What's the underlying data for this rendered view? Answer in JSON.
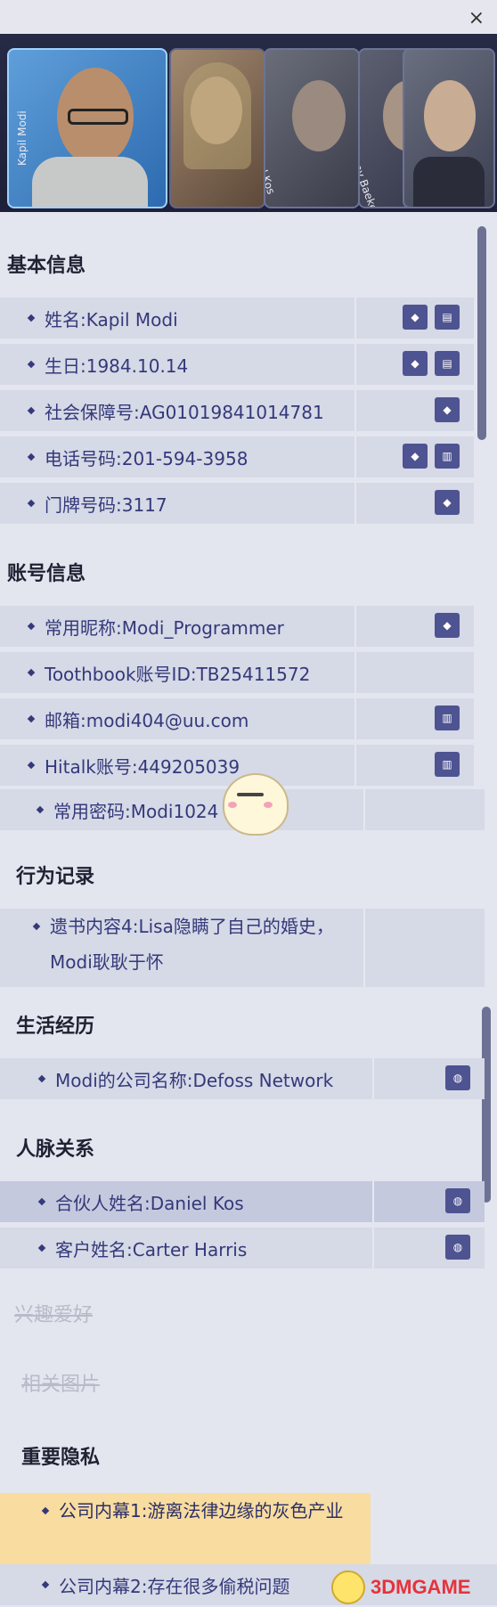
{
  "window": {
    "close_label": "×"
  },
  "characters": [
    {
      "name": "Kapil Modi",
      "active": true
    },
    {
      "name": ""
    },
    {
      "name": "Daniel Kos"
    },
    {
      "name": "Antony Baekeland"
    },
    {
      "name": ""
    }
  ],
  "sections": {
    "basic": {
      "title": "基本信息",
      "rows": [
        {
          "label": "姓名:Kapil Modi",
          "icons": [
            "shield-icon",
            "id-card-icon"
          ]
        },
        {
          "label": "生日:1984.10.14",
          "icons": [
            "shield-icon",
            "id-card-icon"
          ]
        },
        {
          "label": "社会保障号:AG01019841014781",
          "icons": [
            "shield-icon"
          ]
        },
        {
          "label": "电话号码:201-594-3958",
          "icons": [
            "shield-icon",
            "document-icon"
          ]
        },
        {
          "label": "门牌号码:3117",
          "icons": [
            "shield-icon"
          ]
        }
      ]
    },
    "account": {
      "title": "账号信息",
      "rows": [
        {
          "label": "常用昵称:Modi_Programmer",
          "icons": [
            "shield-icon"
          ]
        },
        {
          "label": "Toothbook账号ID:TB25411572",
          "icons": []
        },
        {
          "label": "邮箱:modi404@uu.com",
          "icons": [
            "document-icon"
          ]
        },
        {
          "label": "Hitalk账号:449205039",
          "icons": [
            "document-icon"
          ]
        },
        {
          "label": "常用密码:Modi1024",
          "icons": []
        }
      ]
    },
    "behavior": {
      "title": "行为记录",
      "rows": [
        {
          "label": "遗书内容4:Lisa隐瞒了自己的婚史，Modi耿耿于怀",
          "icons": []
        }
      ]
    },
    "life": {
      "title": "生活经历",
      "rows": [
        {
          "label": "Modi的公司名称:Defoss Network",
          "icons": [
            "globe-icon"
          ]
        }
      ]
    },
    "network": {
      "title": "人脉关系",
      "rows": [
        {
          "label": "合伙人姓名:Daniel Kos",
          "icons": [
            "globe-icon"
          ]
        },
        {
          "label": "客户姓名:Carter Harris",
          "icons": [
            "globe-icon"
          ]
        }
      ]
    },
    "hobby": {
      "title": "兴趣爱好"
    },
    "photos": {
      "title": "相关图片"
    },
    "privacy": {
      "title": "重要隐私",
      "rows": [
        {
          "label": "公司内幕1:游离法律边缘的灰色产业",
          "icons": []
        },
        {
          "label": "公司内幕2:存在很多偷税问题",
          "icons": []
        }
      ]
    }
  },
  "watermark": "3DMGAME"
}
